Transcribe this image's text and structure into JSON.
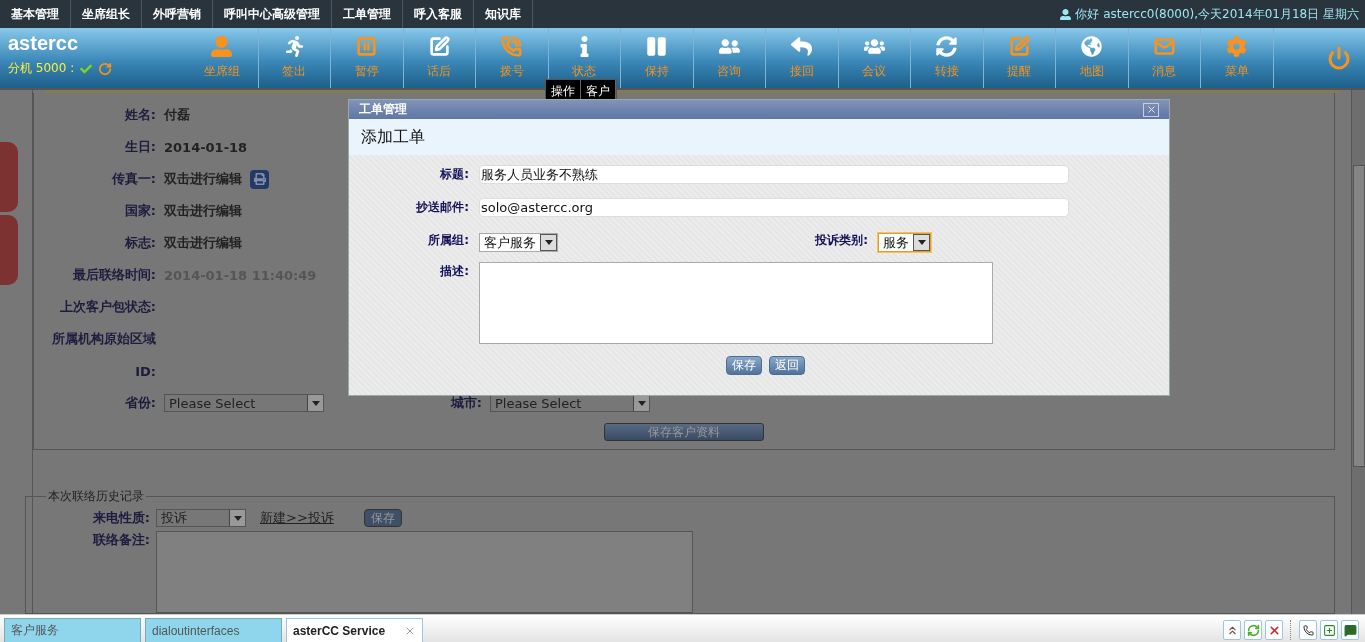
{
  "top_menu": [
    {
      "label": "基本管理"
    },
    {
      "label": "坐席组长"
    },
    {
      "label": "外呼营销"
    },
    {
      "label": "呼叫中心高级管理"
    },
    {
      "label": "工单管理"
    },
    {
      "label": "呼入客服"
    },
    {
      "label": "知识库"
    }
  ],
  "greeting": "你好 astercc0(8000),今天2014年01月18日 星期六",
  "brand": {
    "name": "astercc",
    "extension": "分机 5000 :"
  },
  "toolbar": [
    {
      "label": "坐席组",
      "color": "#f7931e"
    },
    {
      "label": "签出",
      "color": "#ffffff"
    },
    {
      "label": "暂停",
      "color": "#f7931e"
    },
    {
      "label": "话后",
      "color": "#ffffff"
    },
    {
      "label": "拨号",
      "color": "#f7931e"
    },
    {
      "label": "状态",
      "color": "#ffffff"
    },
    {
      "label": "保持",
      "color": "#ffffff"
    },
    {
      "label": "咨询",
      "color": "#ffffff"
    },
    {
      "label": "接回",
      "color": "#ffffff"
    },
    {
      "label": "会议",
      "color": "#ffffff"
    },
    {
      "label": "转接",
      "color": "#ffffff"
    },
    {
      "label": "提醒",
      "color": "#f7931e"
    },
    {
      "label": "地图",
      "color": "#ffffff"
    },
    {
      "label": "消息",
      "color": "#f7931e"
    },
    {
      "label": "菜单",
      "color": "#f7931e"
    }
  ],
  "tooltip": [
    "操作",
    "客户"
  ],
  "customer": {
    "fields": [
      {
        "label": "姓名:",
        "value": "付磊",
        "kind": "text"
      },
      {
        "label": "生日:",
        "value": "2014-01-18",
        "kind": "text"
      },
      {
        "label": "传真一:",
        "value": "双击进行编辑",
        "kind": "fax"
      },
      {
        "label": "国家:",
        "value": "双击进行编辑",
        "kind": "text"
      },
      {
        "label": "标志:",
        "value": "双击进行编辑",
        "kind": "text"
      },
      {
        "label": "最后联络时间:",
        "value": "2014-01-18 11:40:49",
        "kind": "muted"
      },
      {
        "label": "上次客户包状态:",
        "kind": "empty"
      },
      {
        "label": "所属机构原始区域",
        "kind": "empty"
      },
      {
        "label": "ID:",
        "kind": "empty"
      }
    ],
    "province": {
      "label": "省份:",
      "value": "Please Select"
    },
    "city": {
      "label": "城市:",
      "value": "Please Select"
    },
    "save": "保存客户资料"
  },
  "history": {
    "legend": "本次联络历史记录",
    "call_type": {
      "label": "来电性质:",
      "value": "投诉"
    },
    "link": "新建>>投诉",
    "save": "保存",
    "note_label": "联络备注:"
  },
  "dialog": {
    "title": "工单管理",
    "heading": "添加工单",
    "subject": {
      "label": "标题:",
      "value": "服务人员业务不熟练"
    },
    "cc_email": {
      "label": "抄送邮件:",
      "value": "solo@astercc.org"
    },
    "group": {
      "label": "所属组:",
      "value": "客户服务"
    },
    "complaint_type": {
      "label": "投诉类别:",
      "value": "服务",
      "focused": true
    },
    "description": {
      "label": "描述:"
    },
    "buttons": [
      "保存",
      "返回"
    ]
  },
  "bottom_tabs": [
    {
      "label": "客户服务",
      "selected": false
    },
    {
      "label": "dialoutinterfaces",
      "selected": false
    },
    {
      "label": "asterCC Service",
      "selected": true
    }
  ]
}
